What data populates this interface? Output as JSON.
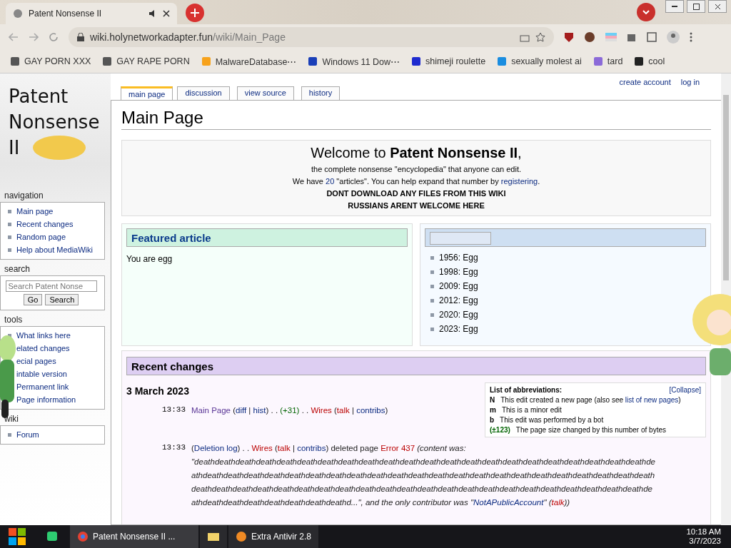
{
  "browser": {
    "tab": {
      "title": "Patent Nonsense II",
      "selected": true
    },
    "url": {
      "host": "wiki.holynetworkadapter.fun",
      "path": "/wiki/Main_Page"
    },
    "bookmarks": [
      {
        "label": "GAY PORN XXX",
        "kind": "globe"
      },
      {
        "label": "GAY RAPE PORN",
        "kind": "globe"
      },
      {
        "label": "MalwareDatabase⋯",
        "kind": "ph"
      },
      {
        "label": "Windows 11 Dow⋯",
        "kind": "x"
      },
      {
        "label": "shimeji roulette",
        "kind": "mft"
      },
      {
        "label": "sexually molest ai",
        "kind": "blue"
      },
      {
        "label": "tard",
        "kind": "purple"
      },
      {
        "label": "cool",
        "kind": "dark"
      }
    ]
  },
  "wiki": {
    "logo": [
      "Patent",
      "Nonsense",
      "II"
    ],
    "personal": [
      "create account",
      "log in"
    ],
    "tabs": [
      {
        "label": "main page",
        "selected": true
      },
      {
        "label": "discussion",
        "selected": false
      },
      {
        "label": "view source",
        "selected": false
      },
      {
        "label": "history",
        "selected": false
      }
    ],
    "sidebar": [
      {
        "title": "navigation",
        "items": [
          "Main page",
          "Recent changes",
          "Random page",
          "Help about MediaWiki"
        ]
      },
      {
        "title": "search",
        "kind": "search",
        "placeholder": "Search Patent Nonse",
        "buttons": [
          "Go",
          "Search"
        ]
      },
      {
        "title": "tools",
        "items": [
          "What links here",
          "elated changes",
          "ecial pages",
          "intable version",
          "Permanent link",
          "Page information"
        ]
      },
      {
        "title": "wiki",
        "items": [
          "Forum"
        ]
      }
    ],
    "title": "Main Page",
    "welcome": {
      "heading": "Welcome to **Patent Nonsense II**,",
      "tagline": "the complete nonsense \"encyclopedia\" that anyone can edit.",
      "count_pre": "We have ",
      "count_link": "20",
      "count_mid": " \"articles\". You can help expand that number by ",
      "register_link": "registering",
      "count_end": ".",
      "notices": [
        "DONT DOWNLOAD ANY FILES FROM THIS WIKI",
        "RUSSIANS ARENT WELCOME HERE"
      ]
    },
    "featured": {
      "heading": "Featured article",
      "text": "You are egg"
    },
    "events": [
      "1956: Egg",
      "1998: Egg",
      "2009: Egg",
      "2012: Egg",
      "2020: Egg",
      "2023: Egg"
    ],
    "recent": {
      "heading": "Recent changes",
      "date": "3 March 2023",
      "legend": {
        "title": "List of abbreviations:",
        "collapse": "[Collapse]",
        "rows": [
          {
            "key": "N",
            "text": "This edit created a new page (also see ",
            "link": "list of new pages",
            "end": ")"
          },
          {
            "key": "m",
            "text": "This is a minor edit"
          },
          {
            "key": "b",
            "text": "This edit was performed by a bot"
          },
          {
            "key": "(±123)",
            "text": "The page size changed by this number of bytes"
          }
        ]
      },
      "entries": [
        {
          "time": "13:33",
          "parts": [
            {
              "t": "Main Page",
              "kind": "page"
            },
            {
              "t": " ("
            },
            {
              "t": "diff",
              "kind": "link"
            },
            {
              "t": " | "
            },
            {
              "t": "hist",
              "kind": "link"
            },
            {
              "t": ") . . "
            },
            {
              "t": "(+31)",
              "kind": "size"
            },
            {
              "t": " . . "
            },
            {
              "t": "Wires",
              "kind": "red"
            },
            {
              "t": " ("
            },
            {
              "t": "talk",
              "kind": "red"
            },
            {
              "t": " | "
            },
            {
              "t": "contribs",
              "kind": "link"
            },
            {
              "t": ")"
            }
          ]
        },
        {
          "time": "13:33",
          "parts": [
            {
              "t": "("
            },
            {
              "t": "Deletion log",
              "kind": "link"
            },
            {
              "t": ") . . "
            },
            {
              "t": "Wires",
              "kind": "red"
            },
            {
              "t": " ("
            },
            {
              "t": "talk",
              "kind": "red"
            },
            {
              "t": " | "
            },
            {
              "t": "contribs",
              "kind": "link"
            },
            {
              "t": ") deleted page "
            },
            {
              "t": "Error 437",
              "kind": "red"
            },
            {
              "t": " (content was: \"deathdeathdeathdeathdeathdeathdeathdeathdeathdeathdeathdeathdeathdeathdeathdeathdeathdeathdeathdeathdeathdeathdeathdeathdeathdeathdeathdeathdeathdeathdeathdeathdeathdeathdeathdeathdeathdeathdeathdeathdeathdeathdeathdeathdeathdeathdeathdeathdeathdeathdeathdeathdeathdeathdeathdeathdeathdeathdeathdeathdeathdeathdeathdeathdeathdeathdeathdeathdeathdeathdeathdeathdeathdeathdeathd...\", and the only contributor was \"",
              "italic": true
            },
            {
              "t": "NotAPublicAccount",
              "kind": "link",
              "italic": true
            },
            {
              "t": "\" (",
              "italic": true
            },
            {
              "t": "talk",
              "kind": "red",
              "italic": true
            },
            {
              "t": "))",
              "italic": true
            }
          ]
        }
      ]
    }
  },
  "taskbar": {
    "apps": [
      {
        "label": "Patent Nonsense II ...",
        "kind": "chrome",
        "selected": true
      },
      {
        "kind": "folder",
        "selected": false
      },
      {
        "label": "Extra Antivir 2.8",
        "kind": "antivir",
        "selected": false
      }
    ],
    "time": "10:18 AM",
    "date": "3/7/2023"
  }
}
